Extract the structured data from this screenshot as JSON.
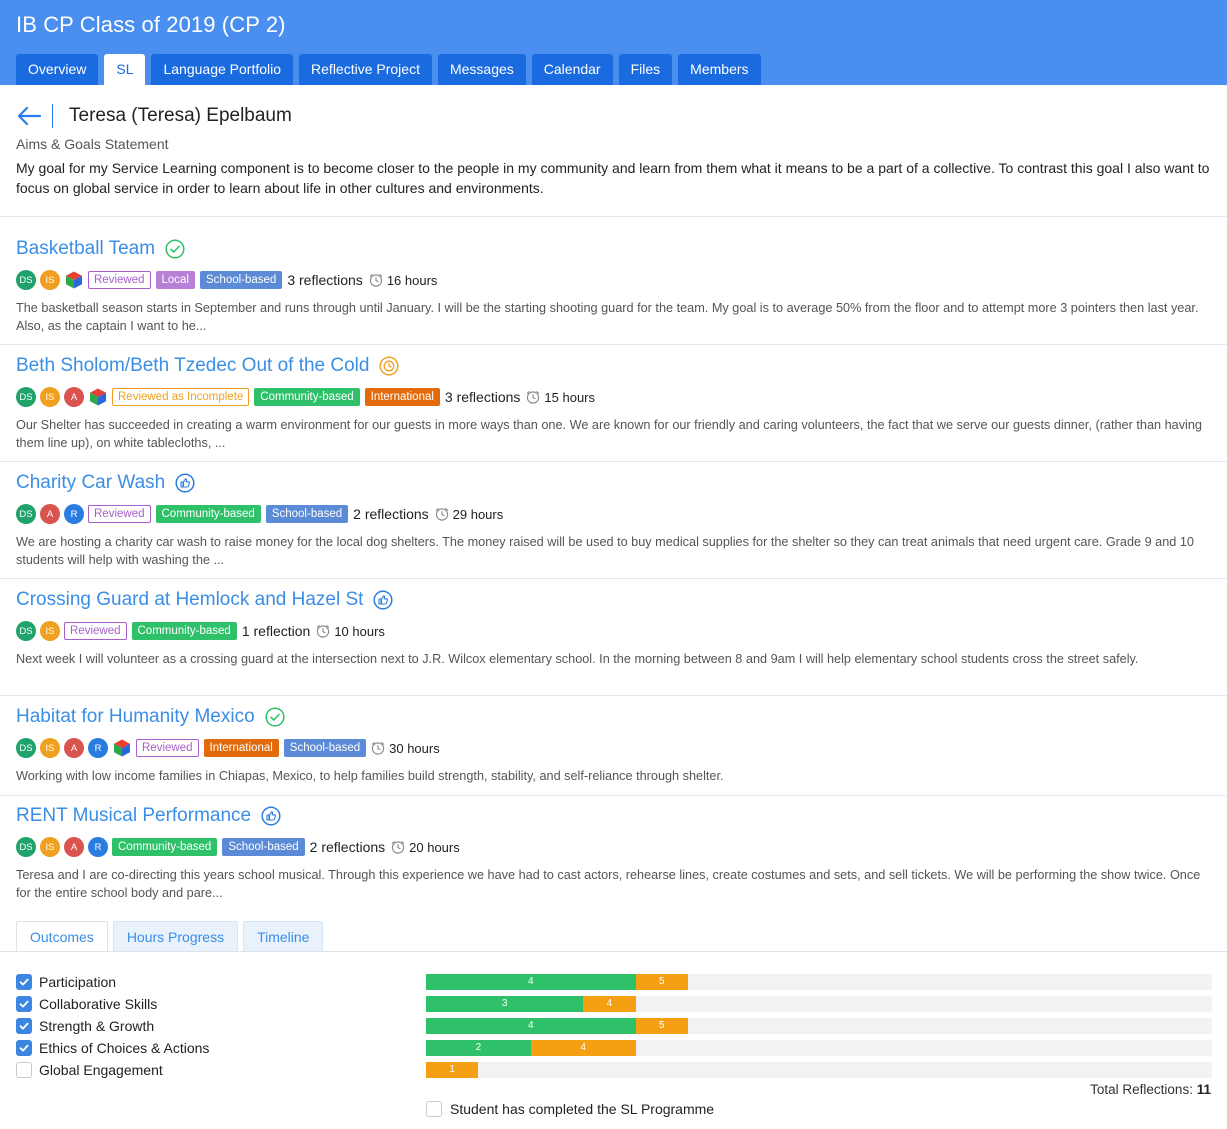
{
  "header": {
    "title": "IB CP Class of 2019 (CP 2)",
    "tabs": [
      {
        "label": "Overview",
        "active": false
      },
      {
        "label": "SL",
        "active": true
      },
      {
        "label": "Language Portfolio",
        "active": false
      },
      {
        "label": "Reflective Project",
        "active": false
      },
      {
        "label": "Messages",
        "active": false
      },
      {
        "label": "Calendar",
        "active": false
      },
      {
        "label": "Files",
        "active": false
      },
      {
        "label": "Members",
        "active": false
      }
    ]
  },
  "student": {
    "name": "Teresa (Teresa) Epelbaum",
    "aims_label": "Aims & Goals Statement",
    "aims_text": "My goal for my Service Learning component is to become closer to the people in my community and learn from them what it means to be a part of a collective. To contrast this goal I also want to focus on global service in order to learn about life in other cultures and environments."
  },
  "colors": {
    "header_bg": "#4a8ff0",
    "tab_bg": "#1a6ae0",
    "link": "#3a8ee6",
    "avatar_DS": "#1fa36b",
    "avatar_IS": "#f0a020",
    "avatar_A": "#d9534f",
    "avatar_R": "#2a7de0",
    "progress_green": "#2ec16a",
    "progress_orange": "#f5a013"
  },
  "projects": [
    {
      "title": "Basketball Team",
      "status_icon": "check-circle-icon",
      "avatars": [
        "DS",
        "IS",
        "cube"
      ],
      "badges": [
        {
          "label": "Reviewed",
          "style": "outline-purple"
        },
        {
          "label": "Local",
          "style": "solid-purple"
        },
        {
          "label": "School-based",
          "style": "solid-blue"
        }
      ],
      "reflections": "3 reflections",
      "hours": "16 hours",
      "description": "The basketball season starts in September and runs through until January. I will be the starting shooting guard for the team. My goal is to average 50% from the floor and to attempt more 3 pointers then last year. Also, as the captain I want to he..."
    },
    {
      "title": "Beth Sholom/Beth Tzedec Out of the Cold",
      "status_icon": "clock-circle-icon",
      "avatars": [
        "DS",
        "IS",
        "A",
        "cube"
      ],
      "badges": [
        {
          "label": "Reviewed as Incomplete",
          "style": "outline-orange"
        },
        {
          "label": "Community-based",
          "style": "solid-green"
        },
        {
          "label": "International",
          "style": "solid-orange"
        }
      ],
      "reflections": "3 reflections",
      "hours": "15 hours",
      "description": "Our Shelter has succeeded in creating a warm environment for our guests in more ways than one. We are known for our friendly and caring volunteers, the fact that we serve our guests dinner, (rather than having them line up), on white tablecloths, ..."
    },
    {
      "title": "Charity Car Wash",
      "status_icon": "thumbs-up-circle-icon",
      "avatars": [
        "DS",
        "A",
        "R"
      ],
      "badges": [
        {
          "label": "Reviewed",
          "style": "outline-purple"
        },
        {
          "label": "Community-based",
          "style": "solid-green"
        },
        {
          "label": "School-based",
          "style": "solid-blue"
        }
      ],
      "reflections": "2 reflections",
      "hours": "29 hours",
      "description": "We are hosting a charity car wash to raise money for the local dog shelters. The money raised will be used to buy medical supplies for the shelter so they can treat animals that need urgent care. Grade 9 and 10 students will help with washing the ..."
    },
    {
      "title": "Crossing Guard at Hemlock and Hazel St",
      "status_icon": "thumbs-up-circle-icon",
      "avatars": [
        "DS",
        "IS"
      ],
      "badges": [
        {
          "label": "Reviewed",
          "style": "outline-purple"
        },
        {
          "label": "Community-based",
          "style": "solid-green"
        }
      ],
      "reflections": "1 reflection",
      "hours": "10 hours",
      "description": "Next week I will volunteer as a crossing guard at the intersection next to J.R. Wilcox elementary school. In the morning between 8 and 9am I will help elementary school students cross the street safely."
    },
    {
      "title": "Habitat for Humanity Mexico",
      "status_icon": "check-circle-icon",
      "avatars": [
        "DS",
        "IS",
        "A",
        "R",
        "cube"
      ],
      "badges": [
        {
          "label": "Reviewed",
          "style": "outline-purple"
        },
        {
          "label": "International",
          "style": "solid-orange"
        },
        {
          "label": "School-based",
          "style": "solid-blue"
        }
      ],
      "reflections": "",
      "hours": "30 hours",
      "description": "Working with low income families in Chiapas, Mexico, to help families build strength, stability, and self-reliance through shelter."
    },
    {
      "title": "RENT Musical Performance",
      "status_icon": "thumbs-up-circle-icon",
      "avatars": [
        "DS",
        "IS",
        "A",
        "R"
      ],
      "badges": [
        {
          "label": "Community-based",
          "style": "solid-green"
        },
        {
          "label": "School-based",
          "style": "solid-blue"
        }
      ],
      "reflections": "2 reflections",
      "hours": "20 hours",
      "description": "Teresa and I are co-directing this years school musical. Through this experience we have had to cast actors, rehearse lines, create costumes and sets, and sell tickets. We will be performing the show twice. Once for the entire school body and pare..."
    }
  ],
  "bottom_tabs": [
    {
      "label": "Outcomes",
      "active": true
    },
    {
      "label": "Hours Progress",
      "active": false
    },
    {
      "label": "Timeline",
      "active": false
    }
  ],
  "outcomes": [
    {
      "label": "Participation",
      "checked": true,
      "green": 4,
      "orange": 5
    },
    {
      "label": "Collaborative Skills",
      "checked": true,
      "green": 3,
      "orange": 4
    },
    {
      "label": "Strength & Growth",
      "checked": true,
      "green": 4,
      "orange": 5
    },
    {
      "label": "Ethics of Choices & Actions",
      "checked": true,
      "green": 2,
      "orange": 4
    },
    {
      "label": "Global Engagement",
      "checked": false,
      "green": 0,
      "orange": 1
    }
  ],
  "outcome_scale_max": 15,
  "total_reflections_label": "Total Reflections:",
  "total_reflections_value": "11",
  "completed_checkbox_label": "Student has completed the SL Programme",
  "completed_checked": false
}
